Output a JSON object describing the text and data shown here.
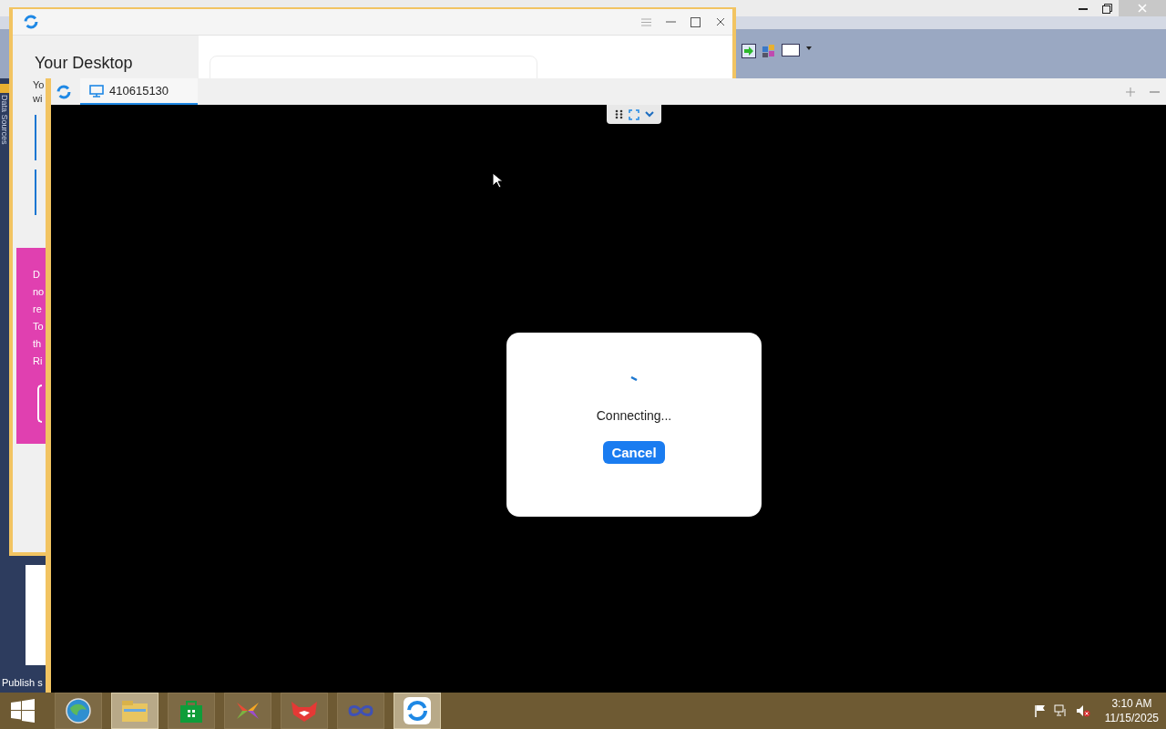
{
  "ide": {
    "side_tab": "Data Sources",
    "status_text": "Publish s"
  },
  "app_window": {
    "heading": "Your Desktop",
    "intro_lines": [
      "Yo",
      "wi"
    ],
    "promo_lines": [
      "D",
      "no",
      "re",
      "To",
      "th",
      "Ri"
    ]
  },
  "remote_window": {
    "tabs": [
      {
        "label": "410615130",
        "selected": true
      }
    ],
    "dialog": {
      "message": "Connecting...",
      "buttons": [
        "Cancel"
      ]
    }
  },
  "taskbar": {
    "apps": [
      {
        "kind": "browser",
        "selected": false
      },
      {
        "kind": "folder",
        "selected": true
      },
      {
        "kind": "store",
        "selected": false
      },
      {
        "kind": "pinwheel",
        "selected": false
      },
      {
        "kind": "fox",
        "selected": false
      },
      {
        "kind": "infinity",
        "selected": false
      },
      {
        "kind": "remote",
        "selected": true
      }
    ],
    "clock": {
      "time": "3:10 AM",
      "date": "11/15/2025"
    }
  }
}
